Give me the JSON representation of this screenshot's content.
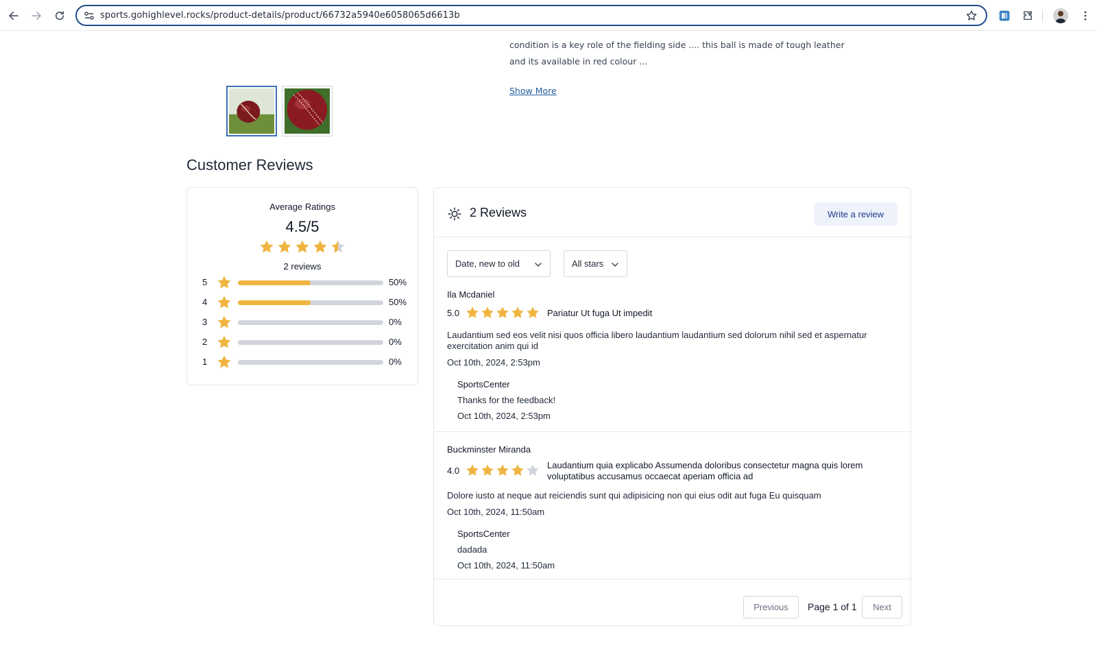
{
  "browser": {
    "url": "sports.gohighlevel.rocks/product-details/product/66732a5940e6058065d6613b"
  },
  "product": {
    "description": "condition is a key role of the fielding side .... this ball is made of tough leather and its available in red colour ...",
    "show_more": "Show More"
  },
  "reviews": {
    "section_title": "Customer Reviews",
    "summary": {
      "label": "Average Ratings",
      "average": "4.5/5",
      "average_value": 4.5,
      "count_text": "2 reviews",
      "distribution": [
        {
          "stars": "5",
          "percent": "50%",
          "fraction": 0.5
        },
        {
          "stars": "4",
          "percent": "50%",
          "fraction": 0.5
        },
        {
          "stars": "3",
          "percent": "0%",
          "fraction": 0
        },
        {
          "stars": "2",
          "percent": "0%",
          "fraction": 0
        },
        {
          "stars": "1",
          "percent": "0%",
          "fraction": 0
        }
      ]
    },
    "header": {
      "count": "2 Reviews",
      "write_button": "Write a review"
    },
    "filters": {
      "sort": "Date, new to old",
      "stars": "All stars"
    },
    "items": [
      {
        "author": "Ila Mcdaniel",
        "score": "5.0",
        "rating": 5,
        "title": "Pariatur Ut fuga Ut impedit",
        "body": "Laudantium sed eos velit nisi quos officia libero laudantium laudantium sed dolorum nihil sed et aspernatur exercitation anim qui id",
        "date": "Oct 10th, 2024, 2:53pm",
        "reply": {
          "author": "SportsCenter",
          "text": "Thanks for the feedback!",
          "date": "Oct 10th, 2024, 2:53pm"
        }
      },
      {
        "author": "Buckminster Miranda",
        "score": "4.0",
        "rating": 4,
        "title": "Laudantium quia explicabo Assumenda doloribus consectetur magna quis lorem voluptatibus accusamus occaecat aperiam officia ad",
        "body": "Dolore iusto at neque aut reiciendis sunt qui adipisicing non qui eius odit aut fuga Eu quisquam",
        "date": "Oct 10th, 2024, 11:50am",
        "reply": {
          "author": "SportsCenter",
          "text": "dadada",
          "date": "Oct 10th, 2024, 11:50am"
        }
      }
    ],
    "pagination": {
      "previous": "Previous",
      "page_text": "Page 1 of 1",
      "next": "Next"
    }
  },
  "colors": {
    "star_filled": "#f0b541",
    "star_empty": "#d1d5db",
    "accent": "#1e3a8a"
  },
  "icons": {
    "back": "back-arrow-icon",
    "forward": "forward-arrow-icon",
    "reload": "reload-icon",
    "site_settings": "tune-icon",
    "bookmark": "star-outline-icon",
    "extension": "puzzle-icon",
    "menu": "kebab-menu-icon",
    "reviews": "sun-icon",
    "dropdown": "chevron-down-icon"
  }
}
